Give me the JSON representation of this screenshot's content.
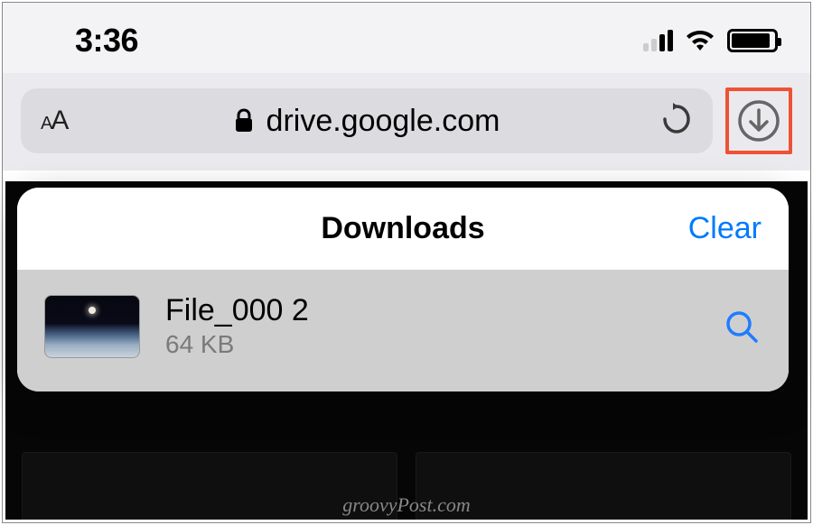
{
  "status": {
    "time": "3:36"
  },
  "toolbar": {
    "text_size_label": "AA",
    "url": "drive.google.com"
  },
  "popover": {
    "title": "Downloads",
    "clear_label": "Clear"
  },
  "downloads": [
    {
      "name": "File_000 2",
      "size": "64 KB"
    }
  ],
  "watermark": "groovyPost.com"
}
